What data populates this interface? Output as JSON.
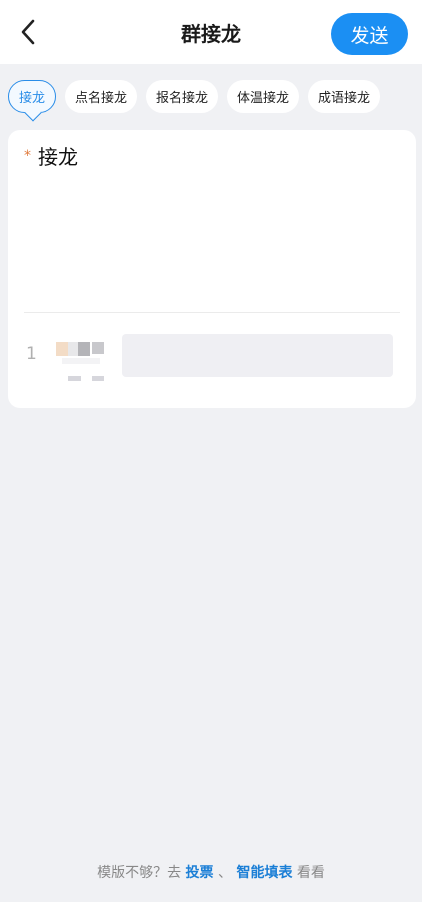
{
  "header": {
    "title": "群接龙",
    "send_label": "发送"
  },
  "chips": [
    {
      "label": "接龙",
      "active": true
    },
    {
      "label": "点名接龙",
      "active": false
    },
    {
      "label": "报名接龙",
      "active": false
    },
    {
      "label": "体温接龙",
      "active": false
    },
    {
      "label": "成语接龙",
      "active": false
    }
  ],
  "card": {
    "required_mark": "*",
    "field_label": "接龙",
    "entry_index": "1"
  },
  "footer": {
    "prefix": "模版不够？去",
    "link_vote": "投票",
    "separator": "、",
    "link_form": "智能填表",
    "suffix": "看看"
  },
  "colors": {
    "accent": "#1b8ff3",
    "required": "#e07b3d",
    "background": "#f0f1f4"
  }
}
